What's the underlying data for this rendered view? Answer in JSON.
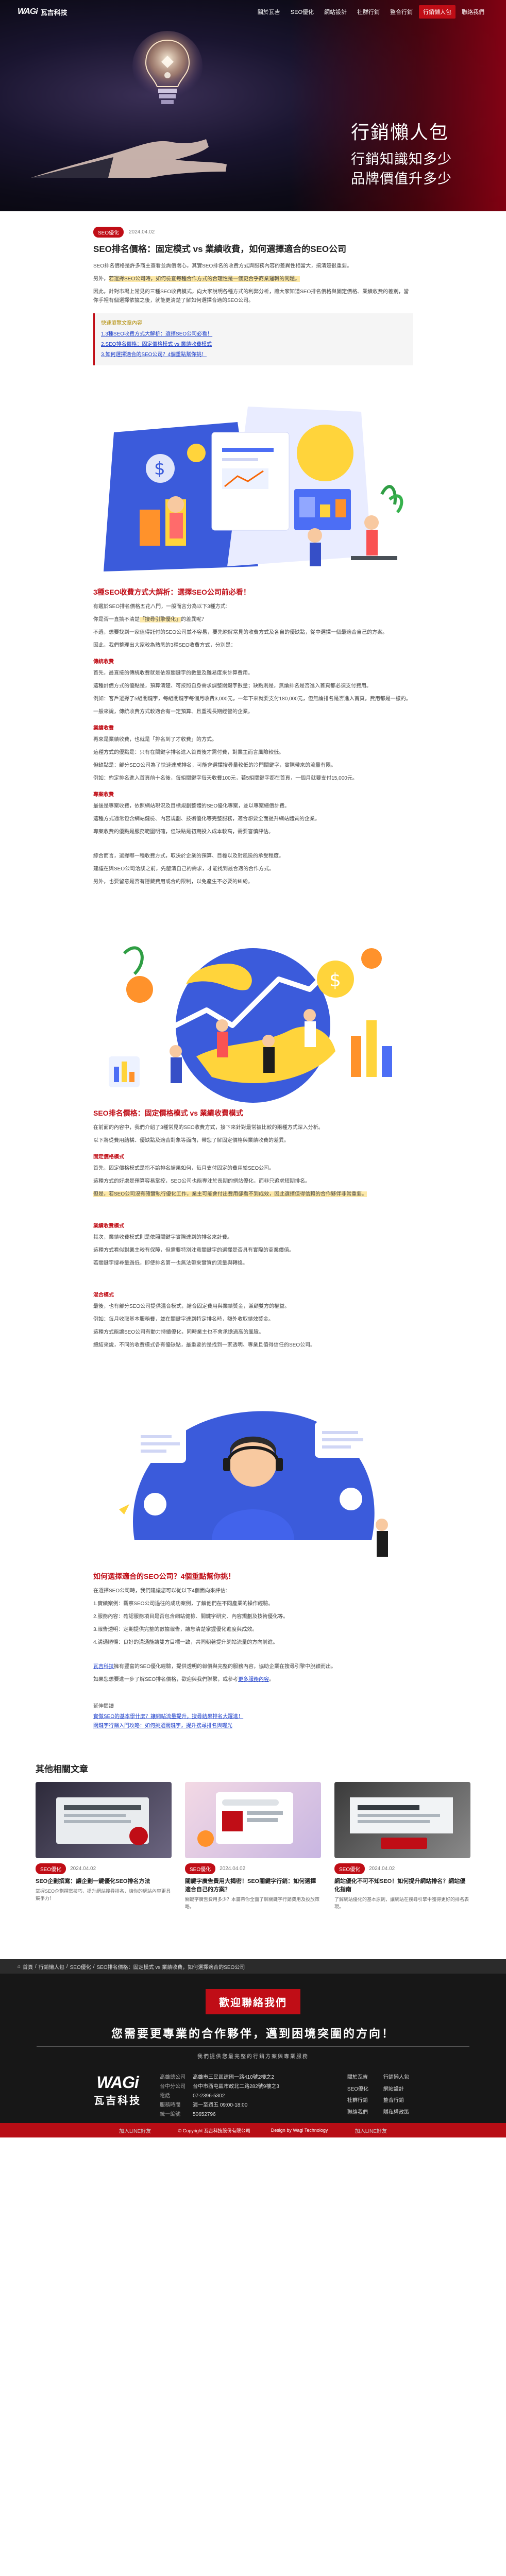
{
  "header": {
    "logo_mark": "WAGi",
    "logo_text": "瓦吉科技",
    "nav": [
      "關於瓦吉",
      "SEO優化",
      "網站設計",
      "社群行銷",
      "整合行銷",
      "行銷懶人包",
      "聯絡我們"
    ]
  },
  "hero": {
    "title": "行銷懶人包",
    "sub1": "行銷知識知多少",
    "sub2": "品牌價值升多少"
  },
  "article": {
    "tag": "SEO優化",
    "date": "2024.04.02",
    "title": "SEO排名價格：固定模式 vs 業績收費，如何選擇適合的SEO公司",
    "intro1": "SEO排名價格是許多商主查看並詢價關心，其實SEO排名的收費方式與服務內容的差異性相當大，搞清楚很重要。",
    "intro2a": "另外，",
    "intro2_hl": "若選擇SEO公司時，如何檢查每種合作方式的合理性是一個更合乎商業邏輯的問題。",
    "intro3": "因此，針對市場上常見的三種SEO收費模式，向大家說明各種方式的利弊分析，讓大家知道SEO排名價格與固定價格、業績收費的差別，當你手裡有個選擇依據之後，就能更清楚了解如何選擇合適的SEO公司。",
    "toc_title": "快速瀏覽文章內容",
    "toc": [
      "1.3種SEO收費方式大解析：選擇SEO公司必看！",
      "2.SEO排名價格：固定價格模式 vs 業績收費模式",
      "3.如何選擇適合的SEO公司？4個重點幫你挑！"
    ],
    "s1_title": "3種SEO收費方式大解析：選擇SEO公司前必看！",
    "s1_p1": "有鑑於SEO排名價格五花八門，一般而言分為以下3種方式：",
    "s1_p2a": "你是否一直搞不清楚",
    "s1_p2_hl": "「搜尋引擎優化」",
    "s1_p2b": "的差異呢？",
    "s1_p3": "不過，想要找到一家值得託付的SEO公司並不容易，要先瞭解常見的收費方式及各自的優缺點，從中選擇一個最適合自己的方案。",
    "s1_p4": "因此，我們整理出大家較為熟悉的3種SEO收費方式，分別是：",
    "m1_h": "傳統收費",
    "m1_p1": "首先，最直接的傳統收費就是依照關鍵字的數量及難易度來計算費用。",
    "m1_p2": "這種計價方式的優點是，預算清楚、可按照自身需求調整關鍵字數量；缺點則是，無論排名是否進入首頁都必須支付費用。",
    "m1_p3": "例如：客戶選擇了5組關鍵字，每組關鍵字每個月收費3,000元，一年下來就要支付180,000元，但無論排名是否進入首頁，費用都是一樣的。",
    "m1_p4": "一般來說，傳統收費方式較適合有一定預算、且重視長期經營的企業。",
    "m2_h": "業績收費",
    "m2_p1": "再來是業績收費，也就是「排名到了才收費」的方式。",
    "m2_p2": "這種方式的優點是：只有在關鍵字排名進入首頁後才需付費，對業主而言風險較低。",
    "m2_p3": "但缺點是：部分SEO公司為了快速達成排名，可能會選擇搜尋量較低的冷門關鍵字，實際帶來的流量有限。",
    "m2_p4": "例如：約定排名進入首頁前十名後，每組關鍵字每天收費100元，若5組關鍵字都在首頁，一個月就要支付15,000元。",
    "m3_h": "專案收費",
    "m3_p1": "最後是專案收費，依照網站現況及目標規劃整體的SEO優化專案，並以專案總價計費。",
    "m3_p2": "這種方式通常包含網站健檢、內容規劃、技術優化等完整服務，適合想要全面提升網站體質的企業。",
    "m3_p3": "專案收費的優點是服務範圍明確，但缺點是初期投入成本較高，需要審慎評估。",
    "s1_p5": "綜合而言，選擇哪一種收費方式，取決於企業的預算、目標以及對風險的承受程度。",
    "s1_p6": "建議在與SEO公司洽談之前，先釐清自己的需求，才能找到最合適的合作方式。",
    "s1_p7": "另外，也要留意是否有隱藏費用或合約限制，以免產生不必要的糾紛。",
    "s2_title": "SEO排名價格：固定價格模式 vs 業績收費模式",
    "s2_p1": "在前面的內容中，我們介紹了3種常見的SEO收費方式，接下來針對最常被比較的兩種方式深入分析。",
    "s2_p2": "以下將從費用結構、優缺點及適合對象等面向，帶您了解固定價格與業績收費的差異。",
    "f_h": "固定價格模式",
    "f_p1": "首先，固定價格模式是指不論排名結果如何，每月支付固定的費用給SEO公司。",
    "f_p2": "這種方式的好處是預算容易掌控，SEO公司也能專注於長期的網站優化，而非只追求短期排名。",
    "f_p3_hl": "但是，若SEO公司沒有確實執行優化工作，業主可能會付出費用卻看不到成效，因此選擇值得信賴的合作夥伴非常重要。",
    "p_h": "業績收費模式",
    "p_p1": "其次，業績收費模式則是依照關鍵字實際達到的排名來計費。",
    "p_p2": "這種方式看似對業主較有保障，但需要特別注意關鍵字的選擇是否具有實際的商業價值。",
    "p_p3": "若關鍵字搜尋量過低，即使排名第一也無法帶來實質的流量與轉換。",
    "h_h": "混合模式",
    "h_p1": "最後，也有部分SEO公司提供混合模式，結合固定費用與業績獎金，兼顧雙方的權益。",
    "h_p2": "例如：每月收取基本服務費，並在關鍵字達到特定排名時，額外收取績效獎金。",
    "h_p3": "這種方式能讓SEO公司有動力持續優化，同時業主也不會承擔過高的風險。",
    "h_p4": "總結來說，不同的收費模式各有優缺點，最重要的是找到一家透明、專業且值得信任的SEO公司。",
    "s3_title": "如何選擇適合的SEO公司？4個重點幫你挑！",
    "s3_p1": "在選擇SEO公司時，我們建議您可以從以下4個面向來評估：",
    "s3_items": [
      "1.實績案例：觀察SEO公司過往的成功案例，了解他們在不同產業的操作經驗。",
      "2.服務內容：確認服務項目是否包含網站健檢、關鍵字研究、內容規劃及技術優化等。",
      "3.報告透明：定期提供完整的數據報告，讓您清楚掌握優化進度與成效。",
      "4.溝通順暢：良好的溝通能讓雙方目標一致，共同朝著提升網站流量的方向前進。"
    ],
    "s3_p2a": "瓦吉科技",
    "s3_p2b": "擁有豐富的SEO優化經驗，提供透明的報價與完整的服務內容，協助企業在搜尋引擎中脫穎而出。",
    "s3_p3a": "如果您想要進一步了解SEO排名價格，歡迎與我們聯繫，或參考",
    "s3_p3_link": "更多服務內容",
    "s3_p3b": "。",
    "ref_title": "延伸閱讀",
    "refs": [
      "實做SEO的基本學什麼？讓網站流量提升，搜尋結果排名大躍進！",
      "關鍵字行銷入門攻略：如何挑選關鍵字，提升搜尋排名與曝光"
    ]
  },
  "related": {
    "title": "其他相關文章",
    "cards": [
      {
        "tag": "SEO優化",
        "date": "2024.04.02",
        "title": "SEO企劃撰寫：讓企劃一鍵優化SEO排名方法",
        "desc": "掌握SEO企劃撰寫技巧，提升網站搜尋排名，讓你的網站內容更具競爭力！"
      },
      {
        "tag": "SEO優化",
        "date": "2024.04.02",
        "title": "關鍵字廣告費用大揭密！SEO關鍵字行銷：如何選擇適合自己的方案？",
        "desc": "關鍵字廣告費用多少？本篇帶你全面了解關鍵字行銷費用及投放策略。"
      },
      {
        "tag": "SEO優化",
        "date": "2024.04.02",
        "title": "網站優化不可不知SEO！如何提升網站排名？網站優化指南",
        "desc": "了解網站優化的基本原則，讓網站在搜尋引擎中獲得更好的排名表現。"
      }
    ]
  },
  "breadcrumb": [
    "首頁",
    "/",
    "行銷懶人包",
    "/",
    "SEO優化",
    "/",
    "SEO排名價格：固定模式 vs 業績收費，如何選擇適合的SEO公司"
  ],
  "cta": {
    "button": "歡迎聯絡我們",
    "headline": "您需要更專業的合作夥伴，邁到困境突圍的方向！",
    "sub": "我們提供您最完整的行銷方案與專業服務"
  },
  "footer": {
    "logo_big": "WAGi",
    "logo_cn": "瓦吉科技",
    "contacts": [
      {
        "k": "高雄總公司",
        "v": "高雄市三民區建國一路410號2樓之2"
      },
      {
        "k": "台中分公司",
        "v": "台中市西屯區市政北二路282號9樓之3"
      },
      {
        "k": "電話",
        "v": "07-2396-5302"
      },
      {
        "k": "服務時間",
        "v": "週一至週五 09:00-18:00"
      },
      {
        "k": "統一編號",
        "v": "50652796"
      }
    ],
    "links": [
      "關於瓦吉",
      "行銷懶人包",
      "SEO優化",
      "網站設計",
      "社群行銷",
      "整合行銷",
      "聯絡我們",
      "隱私權政策"
    ],
    "bottom_left": "加入LINE好友",
    "bottom_right": "加入LINE好友",
    "copyright": "© Copyright 瓦吉科技股份有限公司",
    "design": "Design by Wagi Technology"
  }
}
